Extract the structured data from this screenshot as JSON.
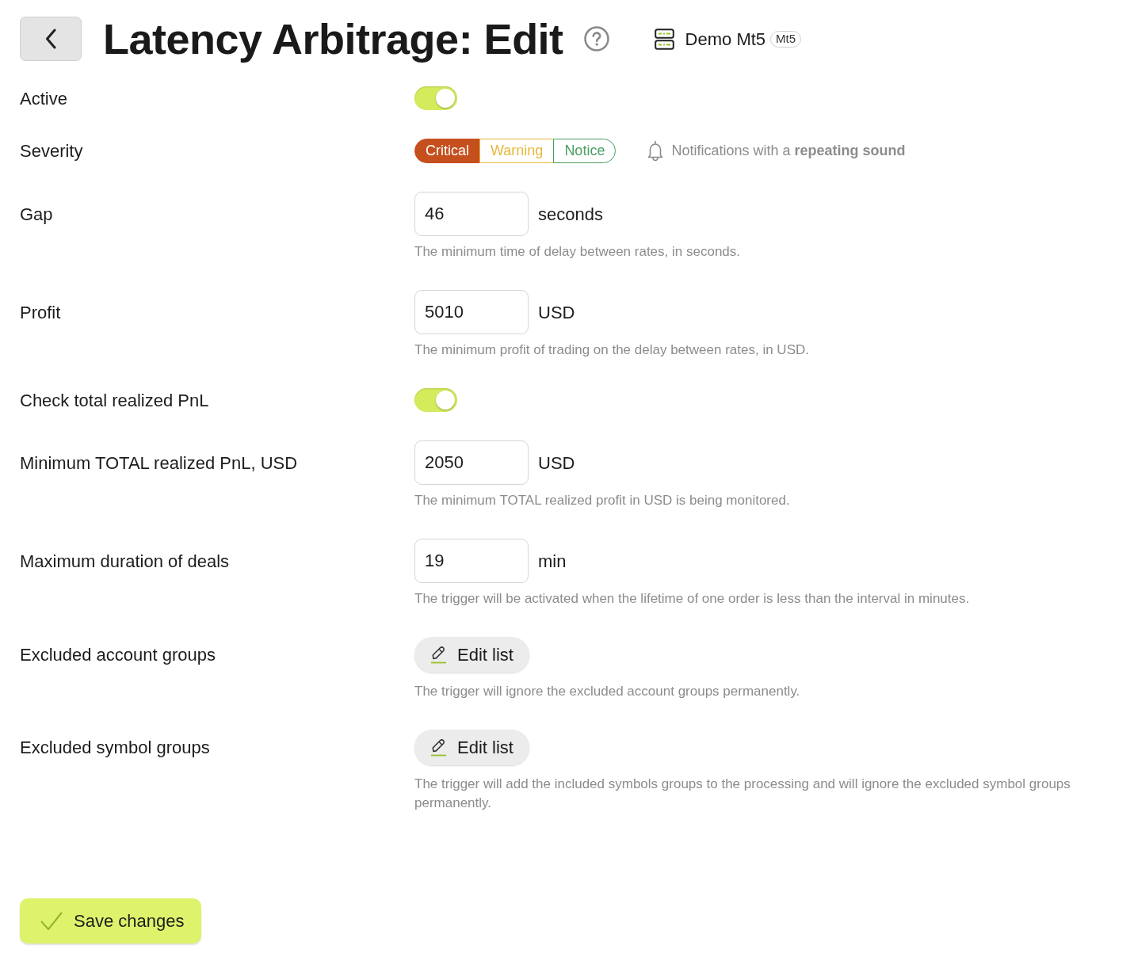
{
  "header": {
    "title": "Latency Arbitrage: Edit",
    "account": "Demo Mt5",
    "account_badge": "Mt5"
  },
  "fields": [
    {
      "kind": "toggle",
      "label": "Active",
      "on": true
    },
    {
      "kind": "severity",
      "label": "Severity",
      "options": [
        {
          "label": "Critical",
          "selected": true,
          "color": "#c54f1d"
        },
        {
          "label": "Warning",
          "selected": false,
          "color": "#e6b83c"
        },
        {
          "label": "Notice",
          "selected": false,
          "color": "#4a9e62"
        }
      ],
      "note": "Notifications with a **repeating sound**"
    },
    {
      "kind": "number",
      "label": "Gap",
      "value": "46",
      "unit": "seconds",
      "hint": "The minimum time of delay between rates, in seconds."
    },
    {
      "kind": "number",
      "label": "Profit",
      "value": "5010",
      "unit": "USD",
      "hint": "The minimum profit of trading on the delay between rates, in USD."
    },
    {
      "kind": "toggle",
      "label": "Check total realized PnL",
      "on": true
    },
    {
      "kind": "number",
      "label": "Minimum TOTAL realized PnL, USD",
      "value": "2050",
      "unit": "USD",
      "hint": "The minimum TOTAL realized profit in USD is being monitored."
    },
    {
      "kind": "number",
      "label": "Maximum duration of deals",
      "value": "19",
      "unit": "min",
      "hint": "The trigger will be activated when the lifetime of one order is less than the interval in minutes."
    },
    {
      "kind": "list",
      "label": "Excluded account groups",
      "button": "Edit list",
      "hint": "The trigger will ignore the excluded account groups permanently."
    },
    {
      "kind": "list",
      "label": "Excluded symbol groups",
      "button": "Edit list",
      "hint": "The trigger will add the included symbols groups to the processing and will ignore the excluded symbol groups permanently."
    }
  ],
  "save_button": "Save changes"
}
